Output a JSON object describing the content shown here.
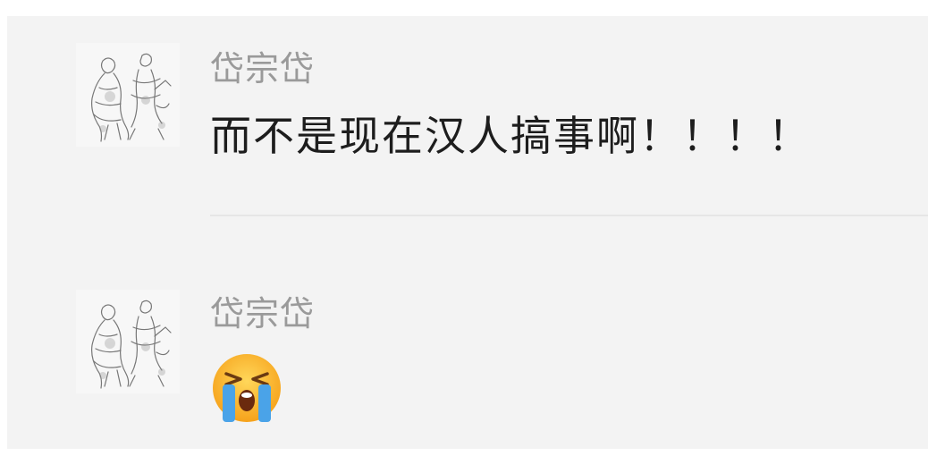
{
  "comments": [
    {
      "username": "岱宗岱",
      "text": "而不是现在汉人搞事啊！！！！",
      "avatar_icon": "sketch-figures-avatar"
    },
    {
      "username": "岱宗岱",
      "emoji_icon": "loudly-crying-face-emoji"
    }
  ],
  "colors": {
    "panel_background": "#f3f3f3",
    "username": "#9a9a9a",
    "text": "#1d1d1d",
    "divider": "#e6e6e6"
  }
}
